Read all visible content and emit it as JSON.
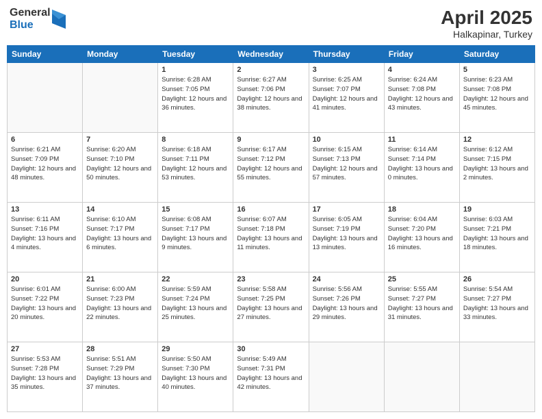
{
  "logo": {
    "general": "General",
    "blue": "Blue"
  },
  "title": {
    "month": "April 2025",
    "location": "Halkapinar, Turkey"
  },
  "weekdays": [
    "Sunday",
    "Monday",
    "Tuesday",
    "Wednesday",
    "Thursday",
    "Friday",
    "Saturday"
  ],
  "weeks": [
    [
      {
        "day": "",
        "info": ""
      },
      {
        "day": "",
        "info": ""
      },
      {
        "day": "1",
        "info": "Sunrise: 6:28 AM\nSunset: 7:05 PM\nDaylight: 12 hours and 36 minutes."
      },
      {
        "day": "2",
        "info": "Sunrise: 6:27 AM\nSunset: 7:06 PM\nDaylight: 12 hours and 38 minutes."
      },
      {
        "day": "3",
        "info": "Sunrise: 6:25 AM\nSunset: 7:07 PM\nDaylight: 12 hours and 41 minutes."
      },
      {
        "day": "4",
        "info": "Sunrise: 6:24 AM\nSunset: 7:08 PM\nDaylight: 12 hours and 43 minutes."
      },
      {
        "day": "5",
        "info": "Sunrise: 6:23 AM\nSunset: 7:08 PM\nDaylight: 12 hours and 45 minutes."
      }
    ],
    [
      {
        "day": "6",
        "info": "Sunrise: 6:21 AM\nSunset: 7:09 PM\nDaylight: 12 hours and 48 minutes."
      },
      {
        "day": "7",
        "info": "Sunrise: 6:20 AM\nSunset: 7:10 PM\nDaylight: 12 hours and 50 minutes."
      },
      {
        "day": "8",
        "info": "Sunrise: 6:18 AM\nSunset: 7:11 PM\nDaylight: 12 hours and 53 minutes."
      },
      {
        "day": "9",
        "info": "Sunrise: 6:17 AM\nSunset: 7:12 PM\nDaylight: 12 hours and 55 minutes."
      },
      {
        "day": "10",
        "info": "Sunrise: 6:15 AM\nSunset: 7:13 PM\nDaylight: 12 hours and 57 minutes."
      },
      {
        "day": "11",
        "info": "Sunrise: 6:14 AM\nSunset: 7:14 PM\nDaylight: 13 hours and 0 minutes."
      },
      {
        "day": "12",
        "info": "Sunrise: 6:12 AM\nSunset: 7:15 PM\nDaylight: 13 hours and 2 minutes."
      }
    ],
    [
      {
        "day": "13",
        "info": "Sunrise: 6:11 AM\nSunset: 7:16 PM\nDaylight: 13 hours and 4 minutes."
      },
      {
        "day": "14",
        "info": "Sunrise: 6:10 AM\nSunset: 7:17 PM\nDaylight: 13 hours and 6 minutes."
      },
      {
        "day": "15",
        "info": "Sunrise: 6:08 AM\nSunset: 7:17 PM\nDaylight: 13 hours and 9 minutes."
      },
      {
        "day": "16",
        "info": "Sunrise: 6:07 AM\nSunset: 7:18 PM\nDaylight: 13 hours and 11 minutes."
      },
      {
        "day": "17",
        "info": "Sunrise: 6:05 AM\nSunset: 7:19 PM\nDaylight: 13 hours and 13 minutes."
      },
      {
        "day": "18",
        "info": "Sunrise: 6:04 AM\nSunset: 7:20 PM\nDaylight: 13 hours and 16 minutes."
      },
      {
        "day": "19",
        "info": "Sunrise: 6:03 AM\nSunset: 7:21 PM\nDaylight: 13 hours and 18 minutes."
      }
    ],
    [
      {
        "day": "20",
        "info": "Sunrise: 6:01 AM\nSunset: 7:22 PM\nDaylight: 13 hours and 20 minutes."
      },
      {
        "day": "21",
        "info": "Sunrise: 6:00 AM\nSunset: 7:23 PM\nDaylight: 13 hours and 22 minutes."
      },
      {
        "day": "22",
        "info": "Sunrise: 5:59 AM\nSunset: 7:24 PM\nDaylight: 13 hours and 25 minutes."
      },
      {
        "day": "23",
        "info": "Sunrise: 5:58 AM\nSunset: 7:25 PM\nDaylight: 13 hours and 27 minutes."
      },
      {
        "day": "24",
        "info": "Sunrise: 5:56 AM\nSunset: 7:26 PM\nDaylight: 13 hours and 29 minutes."
      },
      {
        "day": "25",
        "info": "Sunrise: 5:55 AM\nSunset: 7:27 PM\nDaylight: 13 hours and 31 minutes."
      },
      {
        "day": "26",
        "info": "Sunrise: 5:54 AM\nSunset: 7:27 PM\nDaylight: 13 hours and 33 minutes."
      }
    ],
    [
      {
        "day": "27",
        "info": "Sunrise: 5:53 AM\nSunset: 7:28 PM\nDaylight: 13 hours and 35 minutes."
      },
      {
        "day": "28",
        "info": "Sunrise: 5:51 AM\nSunset: 7:29 PM\nDaylight: 13 hours and 37 minutes."
      },
      {
        "day": "29",
        "info": "Sunrise: 5:50 AM\nSunset: 7:30 PM\nDaylight: 13 hours and 40 minutes."
      },
      {
        "day": "30",
        "info": "Sunrise: 5:49 AM\nSunset: 7:31 PM\nDaylight: 13 hours and 42 minutes."
      },
      {
        "day": "",
        "info": ""
      },
      {
        "day": "",
        "info": ""
      },
      {
        "day": "",
        "info": ""
      }
    ]
  ]
}
